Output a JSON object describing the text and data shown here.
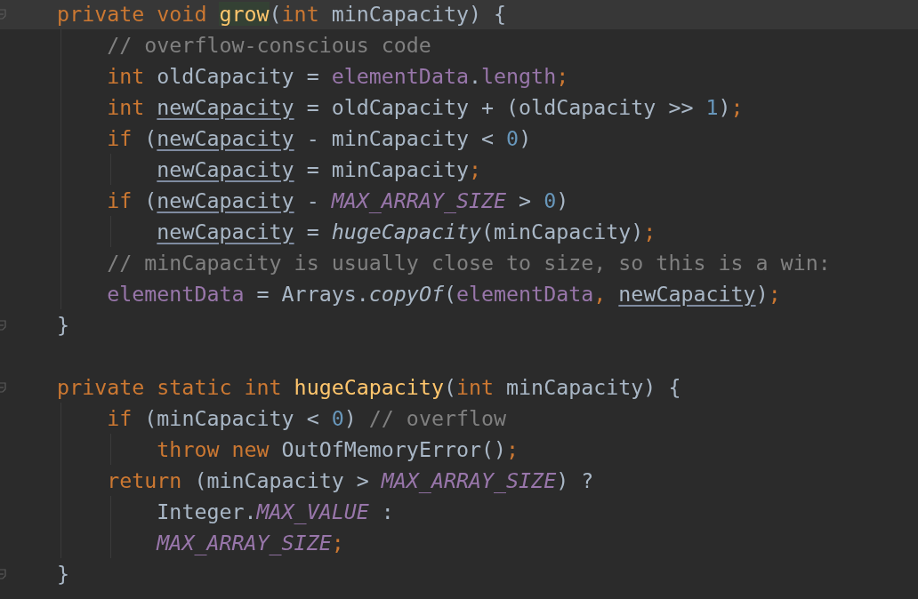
{
  "editor": {
    "lines": [
      {
        "current": true,
        "fold_marker": true,
        "tokens": [
          {
            "kind": "keyword",
            "text": "    private void "
          },
          {
            "kind": "method-match",
            "text": "grow"
          },
          {
            "kind": "plain",
            "text": "("
          },
          {
            "kind": "keyword",
            "text": "int"
          },
          {
            "kind": "plain",
            "text": " minCapacity) {"
          }
        ]
      },
      {
        "current": false,
        "fold_marker": false,
        "tokens": [
          {
            "kind": "comment",
            "text": "        // overflow-conscious code"
          }
        ]
      },
      {
        "current": false,
        "fold_marker": false,
        "tokens": [
          {
            "kind": "keyword",
            "text": "        int"
          },
          {
            "kind": "plain",
            "text": " oldCapacity = "
          },
          {
            "kind": "field",
            "text": "elementData"
          },
          {
            "kind": "plain",
            "text": "."
          },
          {
            "kind": "field",
            "text": "length"
          },
          {
            "kind": "punct",
            "text": ";"
          }
        ]
      },
      {
        "current": false,
        "fold_marker": false,
        "tokens": [
          {
            "kind": "keyword",
            "text": "        int "
          },
          {
            "kind": "variable",
            "text": "newCapacity"
          },
          {
            "kind": "plain",
            "text": " = oldCapacity + (oldCapacity >> "
          },
          {
            "kind": "number",
            "text": "1"
          },
          {
            "kind": "plain",
            "text": ")"
          },
          {
            "kind": "punct",
            "text": ";"
          }
        ]
      },
      {
        "current": false,
        "fold_marker": false,
        "tokens": [
          {
            "kind": "keyword",
            "text": "        if"
          },
          {
            "kind": "plain",
            "text": " ("
          },
          {
            "kind": "variable",
            "text": "newCapacity"
          },
          {
            "kind": "plain",
            "text": " - minCapacity < "
          },
          {
            "kind": "number",
            "text": "0"
          },
          {
            "kind": "plain",
            "text": ")"
          }
        ]
      },
      {
        "current": false,
        "fold_marker": false,
        "tokens": [
          {
            "kind": "variable",
            "text": "            newCapacity"
          },
          {
            "kind": "plain",
            "text": " = minCapacity"
          },
          {
            "kind": "punct",
            "text": ";"
          }
        ]
      },
      {
        "current": false,
        "fold_marker": false,
        "tokens": [
          {
            "kind": "keyword",
            "text": "        if"
          },
          {
            "kind": "plain",
            "text": " ("
          },
          {
            "kind": "variable",
            "text": "newCapacity"
          },
          {
            "kind": "plain",
            "text": " - "
          },
          {
            "kind": "constant",
            "text": "MAX_ARRAY_SIZE"
          },
          {
            "kind": "plain",
            "text": " > "
          },
          {
            "kind": "number",
            "text": "0"
          },
          {
            "kind": "plain",
            "text": ")"
          }
        ]
      },
      {
        "current": false,
        "fold_marker": false,
        "tokens": [
          {
            "kind": "variable",
            "text": "            newCapacity"
          },
          {
            "kind": "plain",
            "text": " = "
          },
          {
            "kind": "static-call",
            "text": "hugeCapacity"
          },
          {
            "kind": "plain",
            "text": "(minCapacity)"
          },
          {
            "kind": "punct",
            "text": ";"
          }
        ]
      },
      {
        "current": false,
        "fold_marker": false,
        "tokens": [
          {
            "kind": "comment",
            "text": "        // minCapacity is usually close to size, so this is a win:"
          }
        ]
      },
      {
        "current": false,
        "fold_marker": false,
        "tokens": [
          {
            "kind": "field",
            "text": "        elementData"
          },
          {
            "kind": "plain",
            "text": " = Arrays."
          },
          {
            "kind": "static-call",
            "text": "copyOf"
          },
          {
            "kind": "plain",
            "text": "("
          },
          {
            "kind": "field",
            "text": "elementData"
          },
          {
            "kind": "punct",
            "text": ", "
          },
          {
            "kind": "variable",
            "text": "newCapacity"
          },
          {
            "kind": "plain",
            "text": ")"
          },
          {
            "kind": "punct",
            "text": ";"
          }
        ]
      },
      {
        "current": false,
        "fold_marker": true,
        "tokens": [
          {
            "kind": "plain",
            "text": "    }"
          }
        ]
      },
      {
        "current": false,
        "fold_marker": false
      },
      {
        "current": false,
        "fold_marker": true,
        "tokens": [
          {
            "kind": "keyword",
            "text": "    private static int "
          },
          {
            "kind": "method",
            "text": "hugeCapacity"
          },
          {
            "kind": "plain",
            "text": "("
          },
          {
            "kind": "keyword",
            "text": "int"
          },
          {
            "kind": "plain",
            "text": " minCapacity) {"
          }
        ]
      },
      {
        "current": false,
        "fold_marker": false,
        "tokens": [
          {
            "kind": "keyword",
            "text": "        if"
          },
          {
            "kind": "plain",
            "text": " (minCapacity < "
          },
          {
            "kind": "number",
            "text": "0"
          },
          {
            "kind": "plain",
            "text": ") "
          },
          {
            "kind": "comment",
            "text": "// overflow"
          }
        ]
      },
      {
        "current": false,
        "fold_marker": false,
        "tokens": [
          {
            "kind": "keyword",
            "text": "            throw new "
          },
          {
            "kind": "plain",
            "text": "OutOfMemoryError()"
          },
          {
            "kind": "punct",
            "text": ";"
          }
        ]
      },
      {
        "current": false,
        "fold_marker": false,
        "tokens": [
          {
            "kind": "keyword",
            "text": "        return"
          },
          {
            "kind": "plain",
            "text": " (minCapacity > "
          },
          {
            "kind": "constant",
            "text": "MAX_ARRAY_SIZE"
          },
          {
            "kind": "plain",
            "text": ") ?"
          }
        ]
      },
      {
        "current": false,
        "fold_marker": false,
        "tokens": [
          {
            "kind": "plain",
            "text": "            Integer."
          },
          {
            "kind": "constant",
            "text": "MAX_VALUE"
          },
          {
            "kind": "plain",
            "text": " :"
          }
        ]
      },
      {
        "current": false,
        "fold_marker": false,
        "tokens": [
          {
            "kind": "constant",
            "text": "            MAX_ARRAY_SIZE"
          },
          {
            "kind": "punct",
            "text": ";"
          }
        ]
      },
      {
        "current": false,
        "fold_marker": true,
        "tokens": [
          {
            "kind": "plain",
            "text": "    }"
          }
        ]
      }
    ]
  }
}
